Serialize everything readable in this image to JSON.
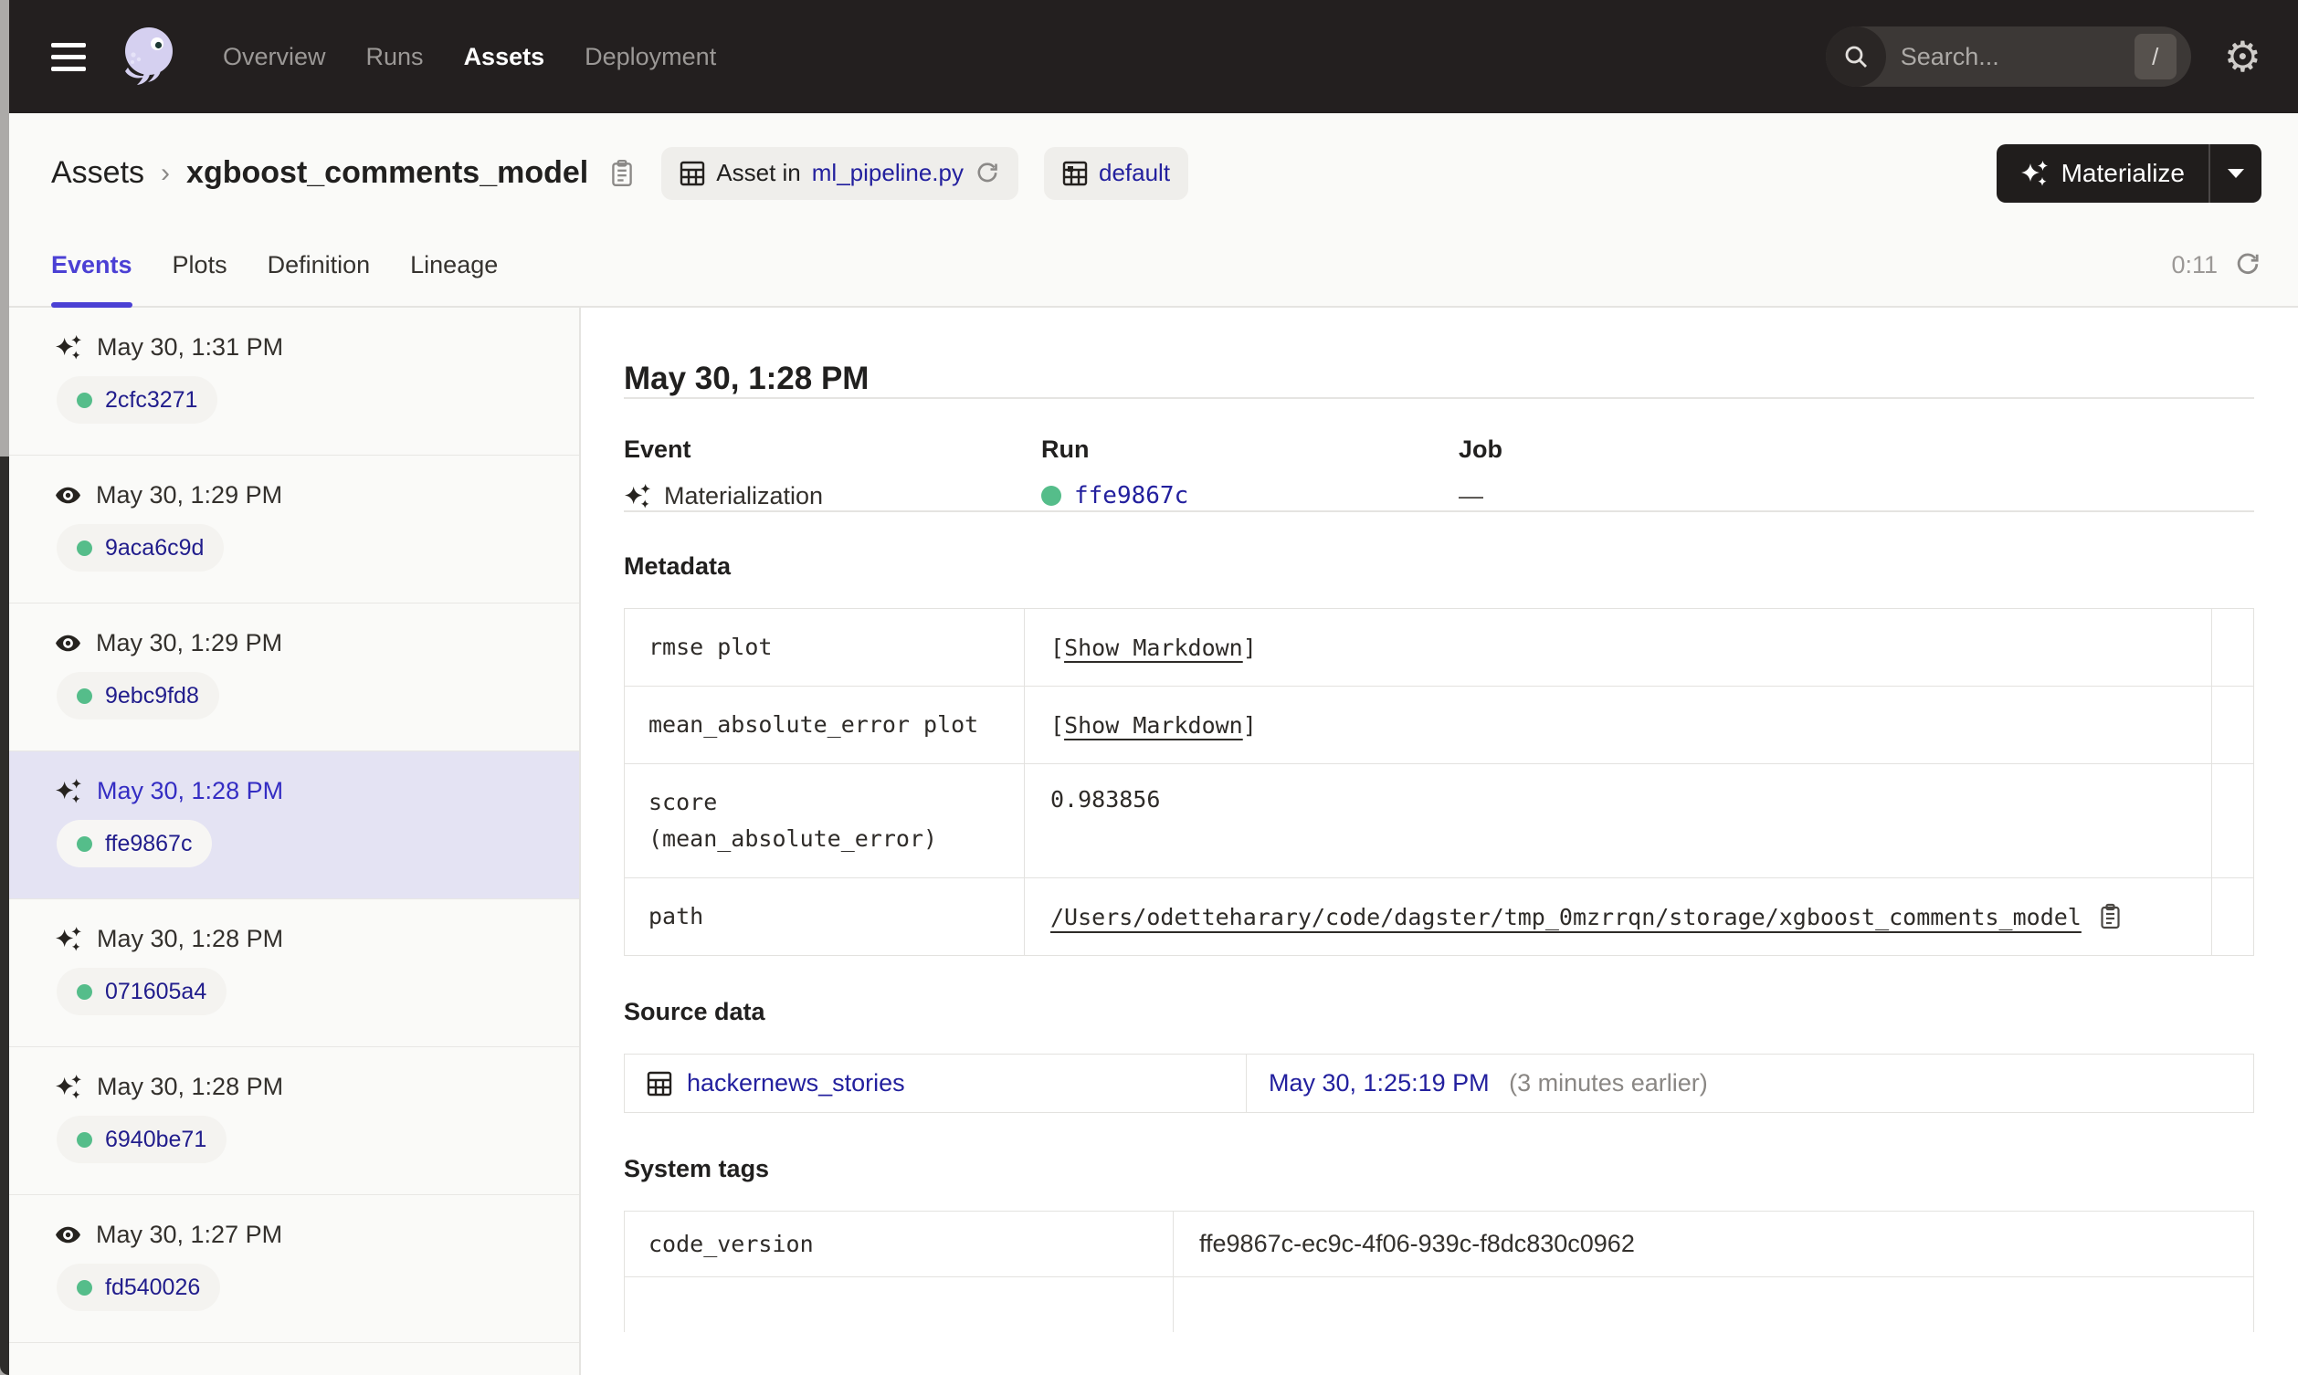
{
  "nav": {
    "items": [
      {
        "label": "Overview",
        "active": false
      },
      {
        "label": "Runs",
        "active": false
      },
      {
        "label": "Assets",
        "active": true
      },
      {
        "label": "Deployment",
        "active": false
      }
    ],
    "search": {
      "placeholder": "Search...",
      "shortcut": "/"
    }
  },
  "breadcrumb": {
    "root": "Assets",
    "separator": "›",
    "asset_name": "xgboost_comments_model"
  },
  "chips": {
    "asset_in_label": "Asset in",
    "asset_in_file": "ml_pipeline.py",
    "group": "default"
  },
  "materialize": {
    "label": "Materialize"
  },
  "tabs": {
    "items": [
      {
        "label": "Events",
        "active": true
      },
      {
        "label": "Plots",
        "active": false
      },
      {
        "label": "Definition",
        "active": false
      },
      {
        "label": "Lineage",
        "active": false
      }
    ],
    "refresh_countdown": "0:11"
  },
  "events_list": [
    {
      "icon": "materialization",
      "timestamp": "May 30, 1:31 PM",
      "run_id": "2cfc3271",
      "selected": false
    },
    {
      "icon": "observation",
      "timestamp": "May 30, 1:29 PM",
      "run_id": "9aca6c9d",
      "selected": false
    },
    {
      "icon": "observation",
      "timestamp": "May 30, 1:29 PM",
      "run_id": "9ebc9fd8",
      "selected": false
    },
    {
      "icon": "materialization",
      "timestamp": "May 30, 1:28 PM",
      "run_id": "ffe9867c",
      "selected": true
    },
    {
      "icon": "materialization",
      "timestamp": "May 30, 1:28 PM",
      "run_id": "071605a4",
      "selected": false
    },
    {
      "icon": "materialization",
      "timestamp": "May 30, 1:28 PM",
      "run_id": "6940be71",
      "selected": false
    },
    {
      "icon": "observation",
      "timestamp": "May 30, 1:27 PM",
      "run_id": "fd540026",
      "selected": false
    }
  ],
  "detail": {
    "heading": "May 30, 1:28 PM",
    "event_label": "Event",
    "event_value": "Materialization",
    "run_label": "Run",
    "run_value": "ffe9867c",
    "job_label": "Job",
    "job_value": "—",
    "metadata": {
      "heading": "Metadata",
      "markdown_link": {
        "open": "[",
        "label": "Show Markdown",
        "close": "]"
      },
      "rows": [
        {
          "key": "rmse plot",
          "value_type": "markdown"
        },
        {
          "key": "mean_absolute_error plot",
          "value_type": "markdown"
        },
        {
          "key_line1": "score",
          "key_line2": "(mean_absolute_error)",
          "value": "0.983856",
          "value_type": "number"
        },
        {
          "key": "path",
          "value": "/Users/odetteharary/code/dagster/tmp_0mzrrqn/storage/xgboost_comments_model",
          "value_type": "path"
        }
      ]
    },
    "source_data": {
      "heading": "Source data",
      "asset": "hackernews_stories",
      "timestamp": "May 30, 1:25:19 PM",
      "relative": "(3 minutes earlier)"
    },
    "system_tags": {
      "heading": "System tags",
      "rows": [
        {
          "key": "code_version",
          "value": "ffe9867c-ec9c-4f06-939c-f8dc830c0962"
        }
      ]
    }
  },
  "colors": {
    "navbar_bg": "#231F1F",
    "accent_purple": "#4B40D4",
    "link_blue": "#23209E",
    "run_link": "#211D8C",
    "selected_row_bg": "#E4E3F3",
    "success_green": "#55BD8A",
    "page_bg": "#FAFAF8",
    "panel_bg": "#FFFFFF",
    "border": "#E3E2DF"
  }
}
